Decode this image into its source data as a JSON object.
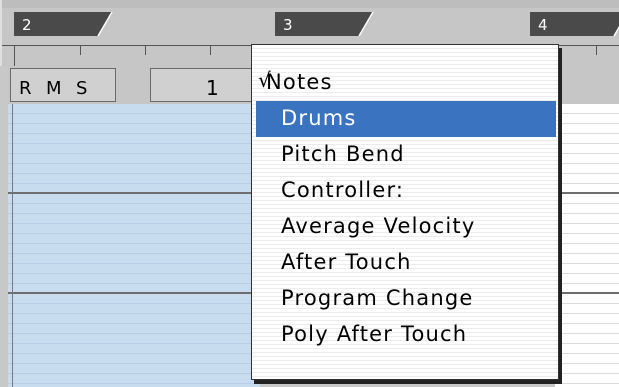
{
  "ruler": {
    "markers": [
      "2",
      "3",
      "4"
    ]
  },
  "track_header": {
    "buttons": [
      "R",
      "M",
      "S"
    ],
    "bar_label": "1"
  },
  "menu": {
    "items": [
      {
        "label": "Notes",
        "checked": "√"
      },
      {
        "label": "Drums"
      },
      {
        "label": "Pitch Bend"
      },
      {
        "label": "Controller:"
      },
      {
        "label": "Average Velocity"
      },
      {
        "label": "After Touch"
      },
      {
        "label": "Program Change"
      },
      {
        "label": "Poly After Touch"
      }
    ],
    "highlighted": "Drums"
  },
  "colors": {
    "highlight": "#3a73c0",
    "lane_blue": "#c8dcf0",
    "marker": "#4a4a4a"
  }
}
